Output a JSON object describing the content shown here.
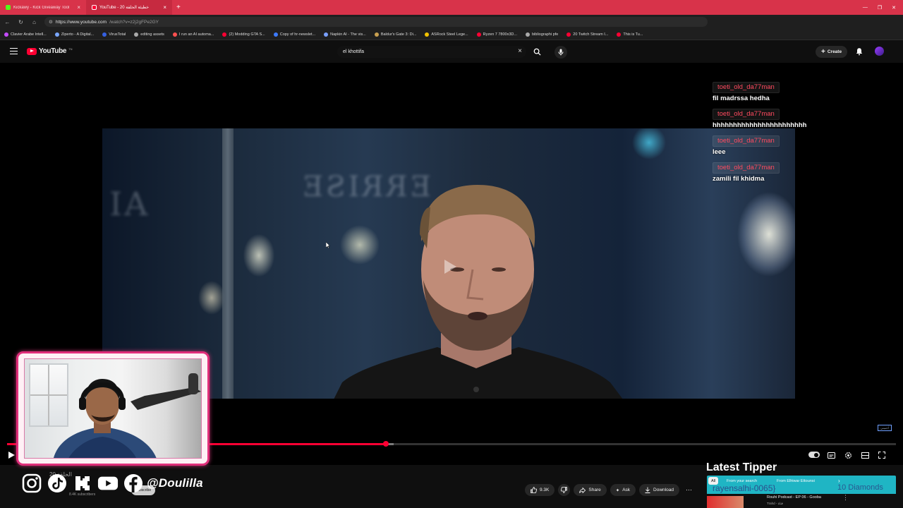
{
  "browser": {
    "tabs": [
      {
        "title": "Kickawy - Kick Giveaway Tool",
        "active": false
      },
      {
        "title": "YouTube - 20 خطيئة الحلقة",
        "active": true
      }
    ],
    "url_host": "https://www.youtube.com",
    "url_path": "/watch?v=z2j2gFPe2GY",
    "bookmarks": [
      {
        "label": "Clavier Arabe Intell...",
        "color": "#c54bff"
      },
      {
        "label": "Ziperto - A Digital...",
        "color": "#7aa7ff"
      },
      {
        "label": "VirusTotal",
        "color": "#3560e0"
      },
      {
        "label": "editing assets",
        "color": "#aaaaaa"
      },
      {
        "label": "I run an AI automa...",
        "color": "#ff4f4f"
      },
      {
        "label": "(2) Modding GTA S...",
        "color": "#ff0033"
      },
      {
        "label": "Copy of hr-newslet...",
        "color": "#3d7bff"
      },
      {
        "label": "Napkin AI - The vis...",
        "color": "#7aa0ff"
      },
      {
        "label": "Baldur's Gate 3: Di...",
        "color": "#c8a050"
      },
      {
        "label": "ASRock Steel Lege...",
        "color": "#f2c200"
      },
      {
        "label": "Ryzen 7 7800x3D...",
        "color": "#ff0033"
      },
      {
        "label": "bibliographi pfe",
        "color": "#aaaaaa"
      },
      {
        "label": "20 Twitch Stream I...",
        "color": "#ff0033"
      },
      {
        "label": "This is Tu...",
        "color": "#ff0033"
      }
    ]
  },
  "youtube": {
    "logo_text": "YouTube",
    "logo_sup": "TN",
    "search_value": "el khottifa",
    "create_label": "Create"
  },
  "chat": [
    {
      "user": "toeti_old_da77man",
      "text": "fil madrssa hedha"
    },
    {
      "user": "toeti_old_da77man",
      "text": "hhhhhhhhhhhhhhhhhhhhhhh"
    },
    {
      "user": "toeti_old_da77man",
      "text": "leee"
    },
    {
      "user": "toeti_old_da77man",
      "text": "zamili fil khidma"
    }
  ],
  "player": {
    "progress_pct": 42.6,
    "loaded_pct": 43.5,
    "end_logo": "أحميني"
  },
  "overlay": {
    "handle": "@Doulilla",
    "latest_tipper_label": "Latest Tipper",
    "tipper_name": "rayensalhi-0065}",
    "tipper_amount": "10 Diamonds"
  },
  "video": {
    "title_partial": "20 الحلقة",
    "subscribers_partial": "8.4K subscribers",
    "subscribe_label": "Subscribe",
    "likes": "9.3K",
    "share_label": "Share",
    "ask_label": "Ask",
    "download_label": "Download"
  },
  "sidebar": {
    "chips": [
      {
        "label": "All"
      },
      {
        "label": "From your search"
      },
      {
        "label": "From Elhiwar Ettounsi"
      }
    ],
    "rec_title": "Rouhi Podcast - EP 06 - Gooba",
    "rec_channel": "Trahd - قناة"
  },
  "colors": {
    "tab_bar": "#d8334a",
    "youtube_red": "#ff0033",
    "chat_name": "#ff4a5f",
    "cam_border": "#e02e7a",
    "tipper_bg": "#1fb5c4"
  }
}
